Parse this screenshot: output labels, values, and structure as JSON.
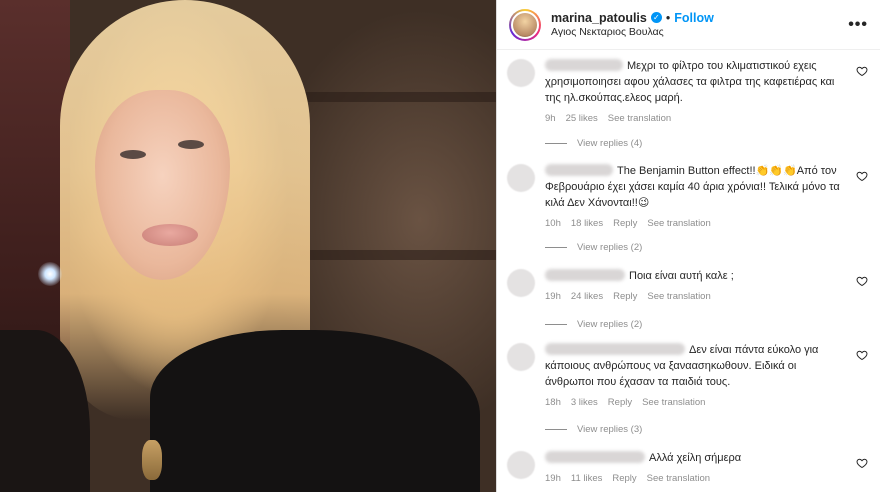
{
  "post": {
    "username": "marina_patoulis",
    "separator": "•",
    "follow_label": "Follow",
    "location": "Αγιος Νεκταριος Βουλας",
    "more_icon": "more-horizontal-icon",
    "verified_icon": "verified-badge-icon"
  },
  "comments": [
    {
      "text": "Μεχρι το φίλτρο του κλιματιστικού εχεις χρησιμοποιησει αφου χάλασες τα φιλτρα της καφετιέρας και της ηλ.σκούπας.ελεος μαρή.",
      "time": "9h",
      "likes": "25 likes",
      "reply": "",
      "translate": "See translation",
      "view_replies": "View replies (4)"
    },
    {
      "text": "The Benjamin Button effect!!👏👏👏Από τον Φεβρουάριο έχει χάσει καμία 40 άρια χρόνια!! Τελικά μόνο τα κιλά Δεν Χάνονται!!😉",
      "time": "10h",
      "likes": "18 likes",
      "reply": "Reply",
      "translate": "See translation",
      "view_replies": "View replies (2)"
    },
    {
      "text": "Ποια είναι αυτή καλε ;",
      "time": "19h",
      "likes": "24 likes",
      "reply": "Reply",
      "translate": "See translation",
      "view_replies": "View replies (2)"
    },
    {
      "text": "Δεν είναι πάντα εύκολο για κάποιους ανθρώπους να ξαναασηκωθουν. Ειδικά οι άνθρωποι που έχασαν τα παιδιά τους.",
      "time": "18h",
      "likes": "3 likes",
      "reply": "Reply",
      "translate": "See translation",
      "view_replies": "View replies (3)"
    },
    {
      "text": "Αλλά χείλη σήμερα",
      "time": "19h",
      "likes": "11 likes",
      "reply": "Reply",
      "translate": "See translation",
      "view_replies": ""
    }
  ],
  "colors": {
    "accent": "#0095f6",
    "muted": "#8e8e8e",
    "text": "#262626"
  }
}
